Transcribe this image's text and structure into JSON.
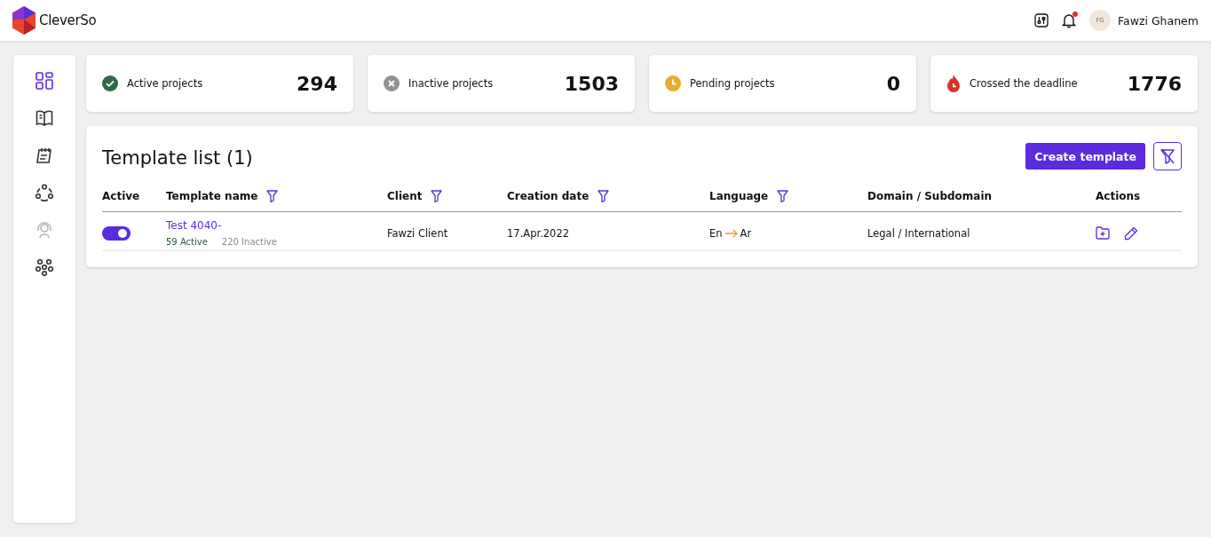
{
  "header": {
    "brand": "CleverSo",
    "user": {
      "initials": "FG",
      "name": "Fawzi Ghanem"
    },
    "notifications_unread": true
  },
  "sidebar": {
    "items": [
      {
        "kind": "dashboard",
        "selected": true,
        "disabled": false
      },
      {
        "kind": "book",
        "selected": false,
        "disabled": false
      },
      {
        "kind": "notepad",
        "selected": false,
        "disabled": false
      },
      {
        "kind": "network",
        "selected": false,
        "disabled": false
      },
      {
        "kind": "support",
        "selected": false,
        "disabled": true
      },
      {
        "kind": "team",
        "selected": false,
        "disabled": false
      }
    ]
  },
  "stats": [
    {
      "kind": "active",
      "label": "Active projects",
      "value": "294"
    },
    {
      "kind": "inactive",
      "label": "Inactive projects",
      "value": "1503"
    },
    {
      "kind": "pending",
      "label": "Pending projects",
      "value": "0"
    },
    {
      "kind": "overdue",
      "label": "Crossed the deadline",
      "value": "1776"
    }
  ],
  "template_list": {
    "title": "Template list (1)",
    "create_button": "Create template",
    "columns": [
      {
        "label": "Active",
        "filter": false
      },
      {
        "label": "Template name",
        "filter": true
      },
      {
        "label": "Client",
        "filter": true
      },
      {
        "label": "Creation date",
        "filter": true
      },
      {
        "label": "Language",
        "filter": true
      },
      {
        "label": "Domain / Subdomain",
        "filter": false
      },
      {
        "label": "Actions",
        "filter": false
      }
    ],
    "rows": [
      {
        "active": true,
        "name": "Test 4040-",
        "active_count": "59 Active",
        "inactive_count": "220 Inactive",
        "client": "Fawzi Client",
        "creation_date": "17.Apr.2022",
        "source_language": "En",
        "target_language": "Ar",
        "domain": "Legal / International"
      }
    ]
  }
}
